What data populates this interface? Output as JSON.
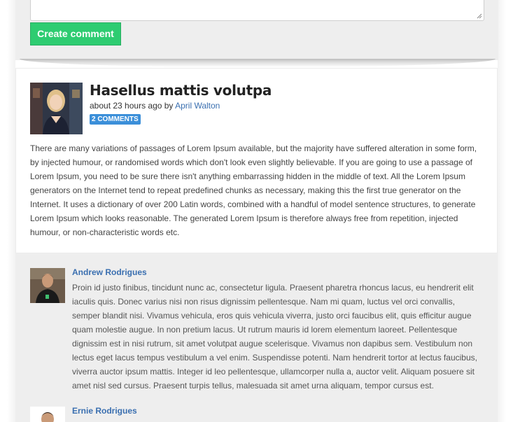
{
  "comment_form": {
    "submit_label": "Create comment"
  },
  "post": {
    "title": "Hasellus mattis volutpa",
    "time_ago": "about 23 hours ago by ",
    "author": "April Walton",
    "comments_badge": "2 COMMENTS",
    "body": "There are many variations of passages of Lorem Ipsum available, but the majority have suffered alteration in some form, by injected humour, or randomised words which don't look even slightly believable. If you are going to use a passage of Lorem Ipsum, you need to be sure there isn't anything embarrassing hidden in the middle of text. All the Lorem Ipsum generators on the Internet tend to repeat predefined chunks as necessary, making this the first true generator on the Internet. It uses a dictionary of over 200 Latin words, combined with a handful of model sentence structures, to generate Lorem Ipsum which looks reasonable. The generated Lorem Ipsum is therefore always free from repetition, injected humour, or non-characteristic words etc."
  },
  "comments": [
    {
      "author": "Andrew Rodrigues",
      "text": "Proin id justo finibus, tincidunt nunc ac, consectetur ligula. Praesent pharetra rhoncus lacus, eu hendrerit elit iaculis quis. Donec varius nisi non risus dignissim pellentesque. Nam mi quam, luctus vel orci convallis, semper blandit nisi. Vivamus vehicula, eros quis vehicula viverra, justo orci faucibus elit, quis efficitur augue quam molestie augue. In non pretium lacus. Ut rutrum mauris id lorem elementum laoreet. Pellentesque dignissim est in nisi rutrum, sit amet volutpat augue scelerisque. Vivamus non dapibus sem. Vestibulum non lectus eget lacus tempus vestibulum a vel enim. Suspendisse potenti. Nam hendrerit tortor at lectus faucibus, viverra auctor ipsum mattis. Integer id leo pellentesque, ullamcorper nulla a, auctor velit. Aliquam posuere sit amet nisl sed cursus. Praesent turpis tellus, malesuada sit amet urna aliquam, tempor cursus est."
    },
    {
      "author": "Ernie Rodrigues",
      "text": ""
    }
  ],
  "colors": {
    "accent_green": "#2ecc71",
    "link_blue": "#3a6fb0",
    "badge_blue": "#3b8fd9",
    "panel_gray": "#eeeeee"
  }
}
